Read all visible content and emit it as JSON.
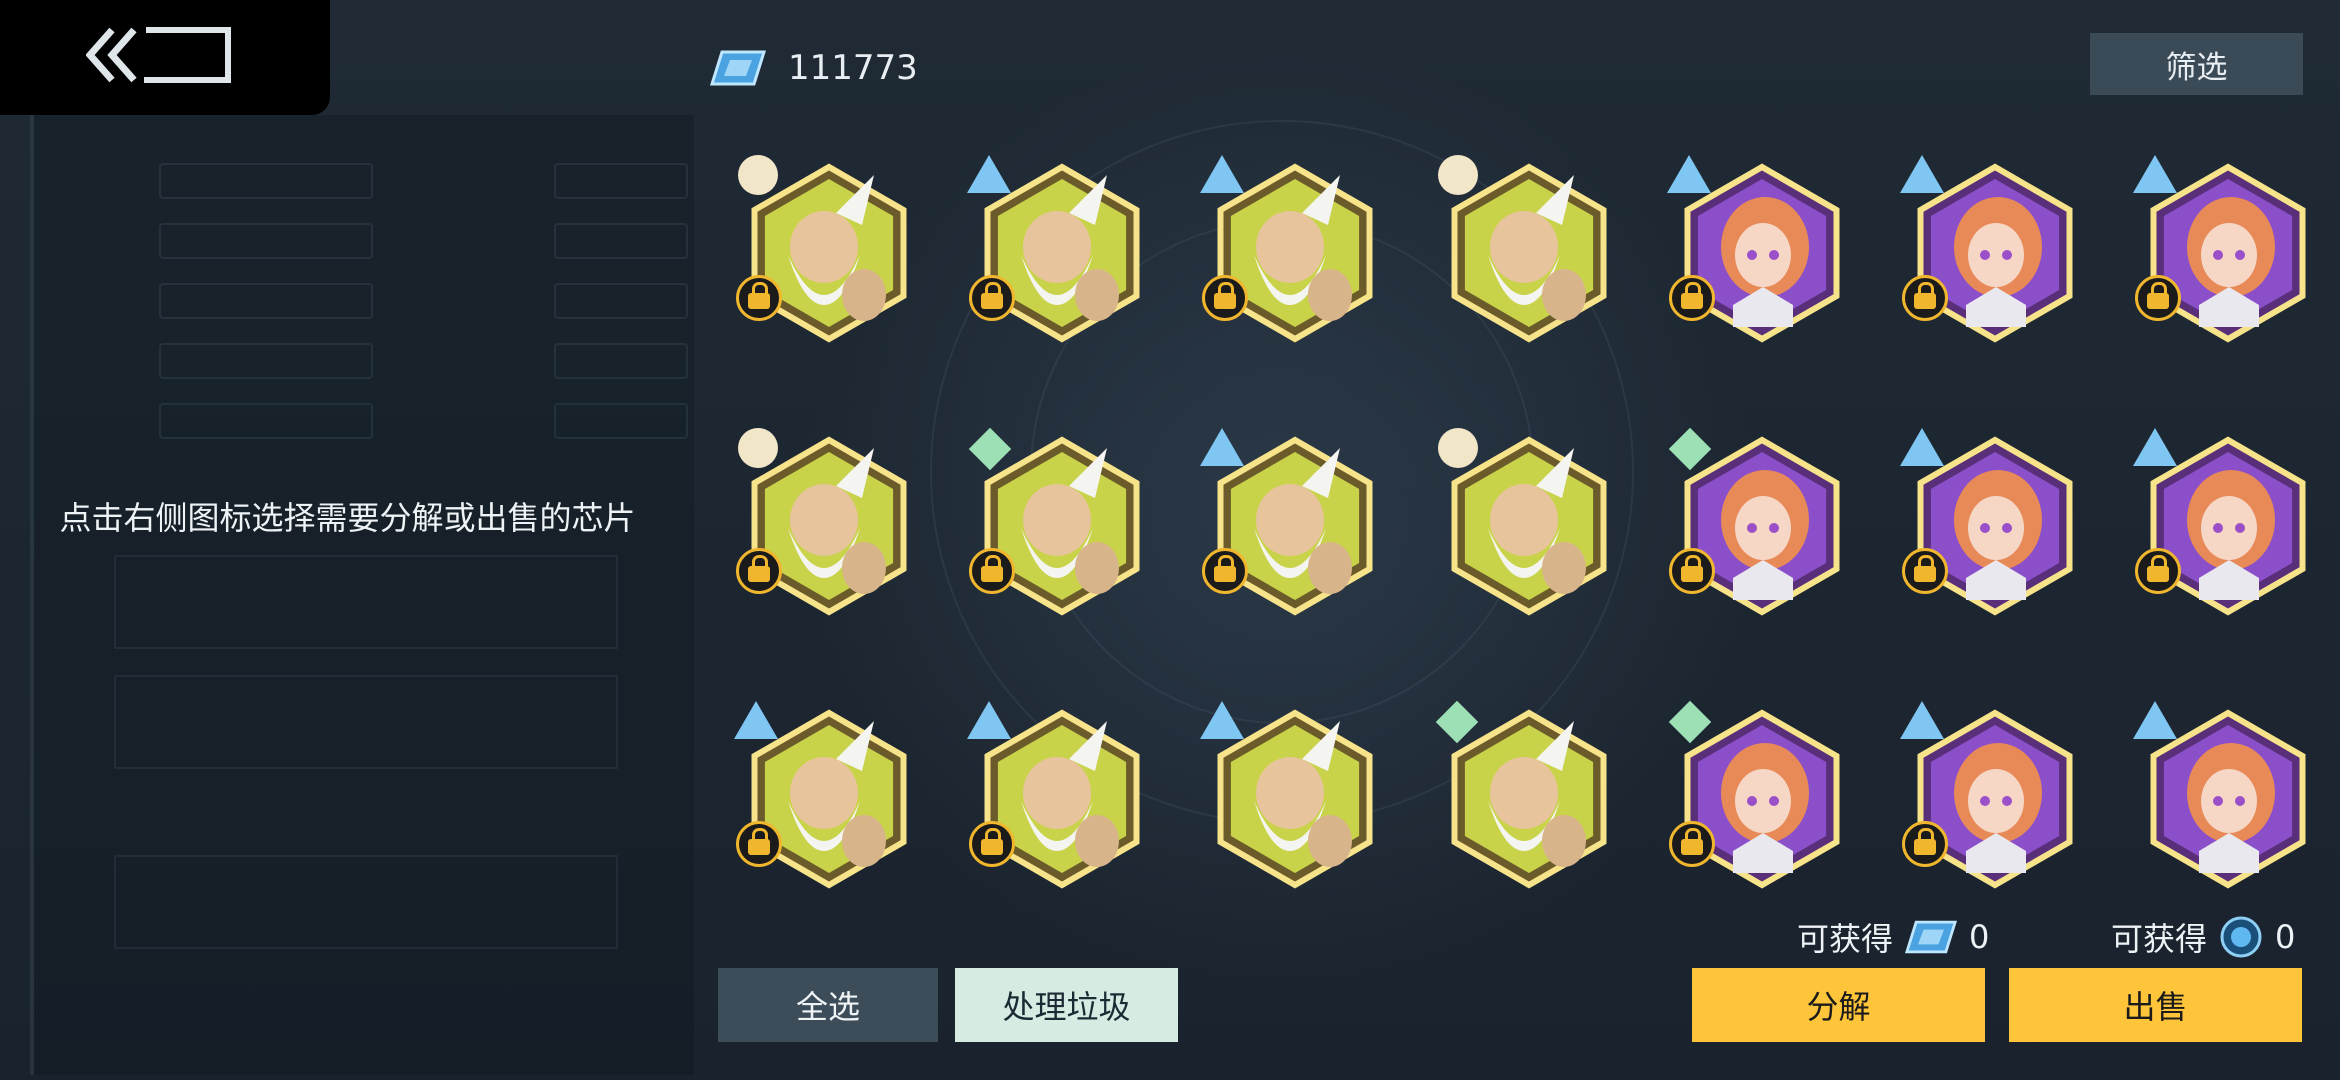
{
  "header": {
    "back_icon": "back-arrow-icon",
    "currency_icon": "chip-ticket-icon",
    "currency_amount": "111773",
    "filter_label": "筛选"
  },
  "left_panel": {
    "hint_text": "点击右侧图标选择需要分解或出售的芯片"
  },
  "chips": [
    {
      "character": "elder-sage",
      "rarity": "circle",
      "locked": true
    },
    {
      "character": "elder-sage",
      "rarity": "triangle",
      "locked": true
    },
    {
      "character": "elder-sage",
      "rarity": "triangle",
      "locked": true
    },
    {
      "character": "elder-sage",
      "rarity": "circle",
      "locked": false
    },
    {
      "character": "orange-hair-girl",
      "rarity": "triangle",
      "locked": true
    },
    {
      "character": "orange-hair-girl",
      "rarity": "triangle",
      "locked": true
    },
    {
      "character": "orange-hair-girl",
      "rarity": "triangle",
      "locked": true
    },
    {
      "character": "elder-sage",
      "rarity": "circle",
      "locked": true
    },
    {
      "character": "elder-sage",
      "rarity": "diamond",
      "locked": true
    },
    {
      "character": "elder-sage",
      "rarity": "triangle",
      "locked": true
    },
    {
      "character": "elder-sage",
      "rarity": "circle",
      "locked": false
    },
    {
      "character": "orange-hair-girl",
      "rarity": "diamond",
      "locked": true
    },
    {
      "character": "orange-hair-girl",
      "rarity": "triangle",
      "locked": true
    },
    {
      "character": "orange-hair-girl",
      "rarity": "triangle",
      "locked": true
    },
    {
      "character": "elder-sage",
      "rarity": "triangle",
      "locked": true
    },
    {
      "character": "elder-sage",
      "rarity": "triangle",
      "locked": true
    },
    {
      "character": "elder-sage",
      "rarity": "triangle",
      "locked": false
    },
    {
      "character": "elder-sage",
      "rarity": "diamond",
      "locked": false
    },
    {
      "character": "orange-hair-girl",
      "rarity": "diamond",
      "locked": true
    },
    {
      "character": "orange-hair-girl",
      "rarity": "triangle",
      "locked": true
    },
    {
      "character": "orange-hair-girl",
      "rarity": "triangle",
      "locked": false
    }
  ],
  "footer": {
    "gain_label_1": "可获得",
    "gain_value_1": "0",
    "gain_icon_1": "chip-ticket-icon",
    "gain_label_2": "可获得",
    "gain_value_2": "0",
    "gain_icon_2": "blue-orb-icon",
    "select_all_label": "全选",
    "process_trash_label": "处理垃圾",
    "decompose_label": "分解",
    "sell_label": "出售"
  },
  "colors": {
    "background": "#1f2a35",
    "accent_yellow": "#fec43a",
    "rarity_circle": "#f2e6c8",
    "rarity_triangle": "#7fc6f2",
    "rarity_diamond": "#9de0b6"
  }
}
